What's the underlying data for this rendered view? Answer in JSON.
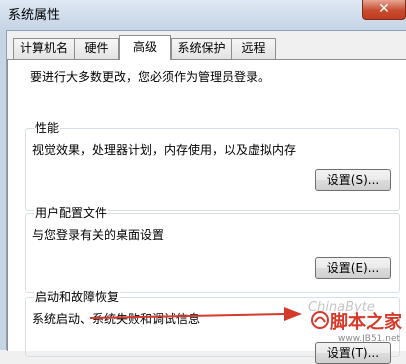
{
  "window": {
    "title": "系统属性",
    "close_glyph": "✕"
  },
  "tabs": [
    {
      "label": "计算机名",
      "active": false
    },
    {
      "label": "硬件",
      "active": false
    },
    {
      "label": "高级",
      "active": true
    },
    {
      "label": "系统保护",
      "active": false
    },
    {
      "label": "远程",
      "active": false
    }
  ],
  "advanced": {
    "admin_notice": "要进行大多数更改，您必须作为管理员登录。",
    "performance": {
      "title": "性能",
      "description": "视觉效果，处理器计划，内存使用，以及虚拟内存",
      "button_label": "设置(S)..."
    },
    "user_profiles": {
      "title": "用户配置文件",
      "description": "与您登录有关的桌面设置",
      "button_label": "设置(E)..."
    },
    "startup_recovery": {
      "title": "启动和故障恢复",
      "description": "系统启动、系统失败和调试信息",
      "button_label": "设置(T)..."
    }
  },
  "annotation": {
    "arrow_color": "#d43a2c",
    "icon": "arrow-right-icon"
  },
  "watermark": {
    "ghost_text": "ChinaByte",
    "main_text": "脚本之家",
    "url_text": "www.JB51.net",
    "color": "#d53a2a"
  },
  "colors": {
    "title_bar": "#c6d5e6",
    "panel": "#ffffff",
    "dialog_bg": "#f0f0f0",
    "close_button": "#c84b30"
  }
}
